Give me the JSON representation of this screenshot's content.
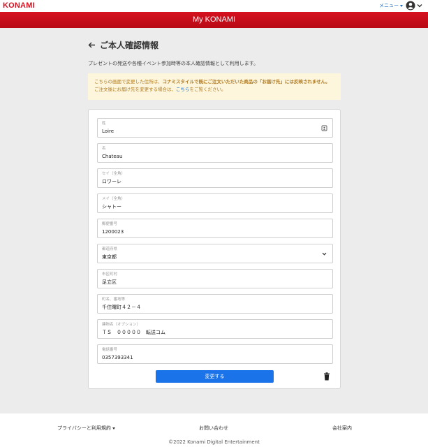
{
  "header": {
    "logo": "KONAMI",
    "menu_label": "メニュー",
    "brand_title": "My KONAMI"
  },
  "page": {
    "title": "ご本人確認情報",
    "description": "プレゼントの発送や各種イベント参加時等の本人確認情報として利用します。"
  },
  "notice": {
    "line1_pre": "こちらの画面で変更した住所は、",
    "line1_em": "コナミスタイルで既にご注文いただいた商品の「お届け先」には反映されません。",
    "line2_pre": "ご注文後にお届け先を変更する場合は、",
    "line2_link": "こちら",
    "line2_post": "をご覧ください。"
  },
  "form": {
    "fields": [
      {
        "label": "姓",
        "value": "Loire"
      },
      {
        "label": "名",
        "value": "Chateau"
      },
      {
        "label": "セイ（全角）",
        "value": "ロワーレ"
      },
      {
        "label": "メイ（全角）",
        "value": "シャトー"
      },
      {
        "label": "郵便番号",
        "value": "1200023"
      },
      {
        "label": "都道府県",
        "value": "東京都"
      },
      {
        "label": "市区町村",
        "value": "足立区"
      },
      {
        "label": "町名、番地等",
        "value": "千住曙町４２－４"
      },
      {
        "label": "建物名（オプション）",
        "value": "ＴＳ　０００００　転送コム"
      },
      {
        "label": "電話番号",
        "value": "0357393341"
      }
    ],
    "submit_label": "変更する"
  },
  "footer": {
    "privacy": "プライバシーと利用規約",
    "contact": "お問い合わせ",
    "company": "会社案内",
    "copyright": "©2022 Konami Digital Entertainment"
  },
  "colors": {
    "brand_red": "#c8101d",
    "primary_blue": "#1a73e8",
    "notice_bg": "#fdf5dc",
    "notice_text": "#b07a1e"
  }
}
